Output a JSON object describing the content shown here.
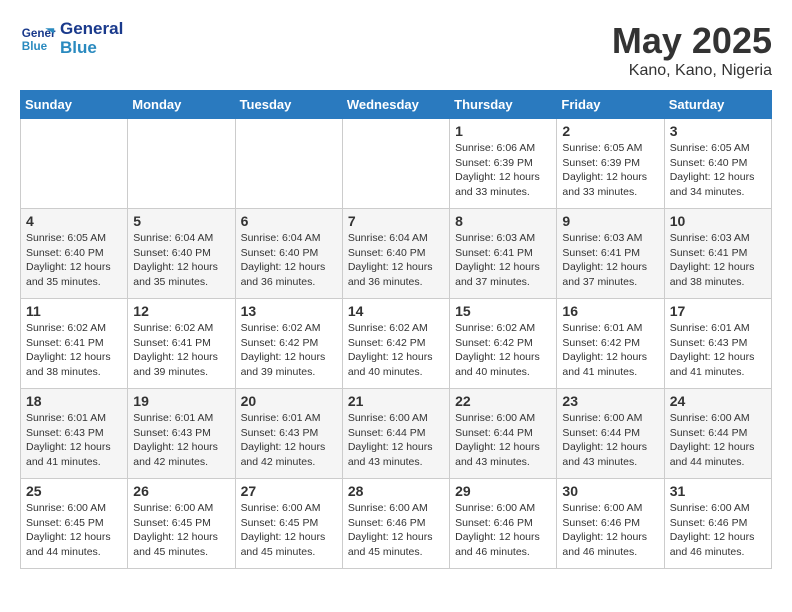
{
  "header": {
    "logo_line1": "General",
    "logo_line2": "Blue",
    "month": "May 2025",
    "location": "Kano, Kano, Nigeria"
  },
  "days_of_week": [
    "Sunday",
    "Monday",
    "Tuesday",
    "Wednesday",
    "Thursday",
    "Friday",
    "Saturday"
  ],
  "weeks": [
    [
      {
        "day": "",
        "info": ""
      },
      {
        "day": "",
        "info": ""
      },
      {
        "day": "",
        "info": ""
      },
      {
        "day": "",
        "info": ""
      },
      {
        "day": "1",
        "info": "Sunrise: 6:06 AM\nSunset: 6:39 PM\nDaylight: 12 hours\nand 33 minutes."
      },
      {
        "day": "2",
        "info": "Sunrise: 6:05 AM\nSunset: 6:39 PM\nDaylight: 12 hours\nand 33 minutes."
      },
      {
        "day": "3",
        "info": "Sunrise: 6:05 AM\nSunset: 6:40 PM\nDaylight: 12 hours\nand 34 minutes."
      }
    ],
    [
      {
        "day": "4",
        "info": "Sunrise: 6:05 AM\nSunset: 6:40 PM\nDaylight: 12 hours\nand 35 minutes."
      },
      {
        "day": "5",
        "info": "Sunrise: 6:04 AM\nSunset: 6:40 PM\nDaylight: 12 hours\nand 35 minutes."
      },
      {
        "day": "6",
        "info": "Sunrise: 6:04 AM\nSunset: 6:40 PM\nDaylight: 12 hours\nand 36 minutes."
      },
      {
        "day": "7",
        "info": "Sunrise: 6:04 AM\nSunset: 6:40 PM\nDaylight: 12 hours\nand 36 minutes."
      },
      {
        "day": "8",
        "info": "Sunrise: 6:03 AM\nSunset: 6:41 PM\nDaylight: 12 hours\nand 37 minutes."
      },
      {
        "day": "9",
        "info": "Sunrise: 6:03 AM\nSunset: 6:41 PM\nDaylight: 12 hours\nand 37 minutes."
      },
      {
        "day": "10",
        "info": "Sunrise: 6:03 AM\nSunset: 6:41 PM\nDaylight: 12 hours\nand 38 minutes."
      }
    ],
    [
      {
        "day": "11",
        "info": "Sunrise: 6:02 AM\nSunset: 6:41 PM\nDaylight: 12 hours\nand 38 minutes."
      },
      {
        "day": "12",
        "info": "Sunrise: 6:02 AM\nSunset: 6:41 PM\nDaylight: 12 hours\nand 39 minutes."
      },
      {
        "day": "13",
        "info": "Sunrise: 6:02 AM\nSunset: 6:42 PM\nDaylight: 12 hours\nand 39 minutes."
      },
      {
        "day": "14",
        "info": "Sunrise: 6:02 AM\nSunset: 6:42 PM\nDaylight: 12 hours\nand 40 minutes."
      },
      {
        "day": "15",
        "info": "Sunrise: 6:02 AM\nSunset: 6:42 PM\nDaylight: 12 hours\nand 40 minutes."
      },
      {
        "day": "16",
        "info": "Sunrise: 6:01 AM\nSunset: 6:42 PM\nDaylight: 12 hours\nand 41 minutes."
      },
      {
        "day": "17",
        "info": "Sunrise: 6:01 AM\nSunset: 6:43 PM\nDaylight: 12 hours\nand 41 minutes."
      }
    ],
    [
      {
        "day": "18",
        "info": "Sunrise: 6:01 AM\nSunset: 6:43 PM\nDaylight: 12 hours\nand 41 minutes."
      },
      {
        "day": "19",
        "info": "Sunrise: 6:01 AM\nSunset: 6:43 PM\nDaylight: 12 hours\nand 42 minutes."
      },
      {
        "day": "20",
        "info": "Sunrise: 6:01 AM\nSunset: 6:43 PM\nDaylight: 12 hours\nand 42 minutes."
      },
      {
        "day": "21",
        "info": "Sunrise: 6:00 AM\nSunset: 6:44 PM\nDaylight: 12 hours\nand 43 minutes."
      },
      {
        "day": "22",
        "info": "Sunrise: 6:00 AM\nSunset: 6:44 PM\nDaylight: 12 hours\nand 43 minutes."
      },
      {
        "day": "23",
        "info": "Sunrise: 6:00 AM\nSunset: 6:44 PM\nDaylight: 12 hours\nand 43 minutes."
      },
      {
        "day": "24",
        "info": "Sunrise: 6:00 AM\nSunset: 6:44 PM\nDaylight: 12 hours\nand 44 minutes."
      }
    ],
    [
      {
        "day": "25",
        "info": "Sunrise: 6:00 AM\nSunset: 6:45 PM\nDaylight: 12 hours\nand 44 minutes."
      },
      {
        "day": "26",
        "info": "Sunrise: 6:00 AM\nSunset: 6:45 PM\nDaylight: 12 hours\nand 45 minutes."
      },
      {
        "day": "27",
        "info": "Sunrise: 6:00 AM\nSunset: 6:45 PM\nDaylight: 12 hours\nand 45 minutes."
      },
      {
        "day": "28",
        "info": "Sunrise: 6:00 AM\nSunset: 6:46 PM\nDaylight: 12 hours\nand 45 minutes."
      },
      {
        "day": "29",
        "info": "Sunrise: 6:00 AM\nSunset: 6:46 PM\nDaylight: 12 hours\nand 46 minutes."
      },
      {
        "day": "30",
        "info": "Sunrise: 6:00 AM\nSunset: 6:46 PM\nDaylight: 12 hours\nand 46 minutes."
      },
      {
        "day": "31",
        "info": "Sunrise: 6:00 AM\nSunset: 6:46 PM\nDaylight: 12 hours\nand 46 minutes."
      }
    ]
  ]
}
